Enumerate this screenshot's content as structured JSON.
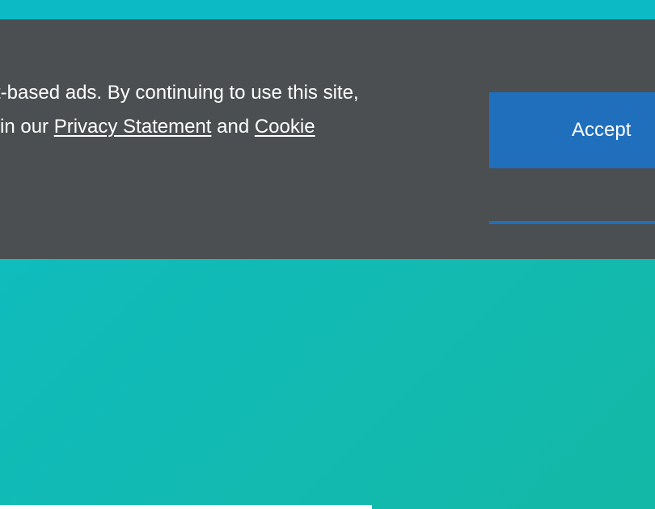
{
  "cookie_banner": {
    "line1": "t-based ads. By continuing to use this site,",
    "line2_prefix": "in our ",
    "privacy_link": "Privacy Statement",
    "line2_middle": " and ",
    "cookie_link": "Cookie",
    "accept_label": "Accept"
  },
  "colors": {
    "banner_background": "#4b4f51",
    "accent_blue": "#1f6fbd",
    "page_teal": "#10bbb8"
  }
}
